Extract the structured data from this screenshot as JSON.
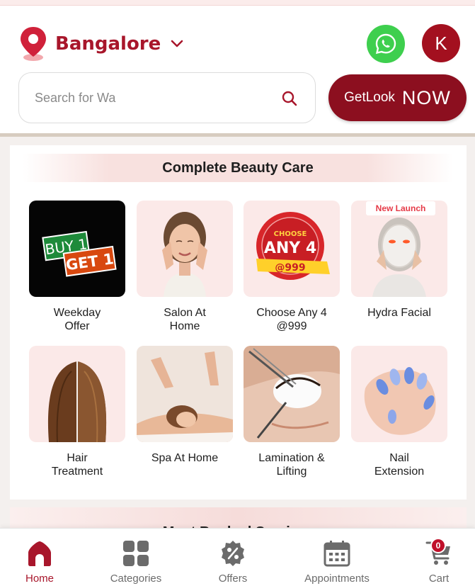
{
  "header": {
    "city": "Bangalore",
    "search": {
      "placeholder": "Search for Wa"
    },
    "avatar_initial": "K",
    "cta": {
      "part1": "GetLook",
      "part2": "NOW"
    }
  },
  "section": {
    "title": "Complete Beauty Care",
    "items": [
      {
        "label": "Weekday\nOffer",
        "art_text": [
          "BUY 1",
          "GET 1"
        ]
      },
      {
        "label": "Salon At\nHome"
      },
      {
        "label": "Choose Any 4\n@999",
        "art_text": [
          "CHOOSE",
          "ANY 4",
          "@999"
        ]
      },
      {
        "label": "Hydra Facial",
        "badge": "New Launch"
      },
      {
        "label": "Hair\nTreatment"
      },
      {
        "label": "Spa At Home"
      },
      {
        "label": "Lamination &\nLifting"
      },
      {
        "label": "Nail\nExtension"
      }
    ]
  },
  "next_section": {
    "title": "Most Booked Services"
  },
  "bottom_nav": {
    "items": [
      {
        "label": "Home",
        "icon": "home-icon",
        "active": true
      },
      {
        "label": "Categories",
        "icon": "grid-icon",
        "active": false
      },
      {
        "label": "Offers",
        "icon": "discount-icon",
        "active": false
      },
      {
        "label": "Appointments",
        "icon": "calendar-icon",
        "active": false
      },
      {
        "label": "Cart",
        "icon": "cart-icon",
        "active": false
      }
    ],
    "cart_count": "0"
  },
  "colors": {
    "brand": "#a8162b",
    "cta": "#8c0f1f",
    "whatsapp": "#3ecf4e",
    "tile_bg": "#fbe9e8"
  }
}
